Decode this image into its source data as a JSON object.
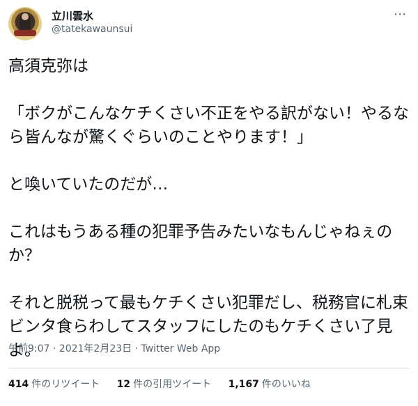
{
  "user": {
    "display_name": "立川雲水",
    "handle": "@tatekawaunsui"
  },
  "icons": {
    "more": "more-horizontal-icon"
  },
  "tweet": {
    "paragraphs": [
      "高須克弥は",
      "「ボクがこんなケチくさい不正をやる訳がない！やるなら皆んなが驚くぐらいのことやります！」",
      "と喚いていたのだが…",
      "これはもうある種の犯罪予告みたいなもんじゃねぇのか？",
      "それと脱税って最もケチくさい犯罪だし、税務官に札束ビンタ食らわしてスタッフにしたのもケチくさい了見よ。"
    ],
    "timestamp": "午前9:07 · 2021年2月23日 · ",
    "app": "Twitter Web App"
  },
  "stats": {
    "retweets_count": "414",
    "retweets_label": "件のリツイート",
    "quotes_count": "12",
    "quotes_label": "件の引用ツイート",
    "likes_count": "1,167",
    "likes_label": "件のいいね"
  }
}
